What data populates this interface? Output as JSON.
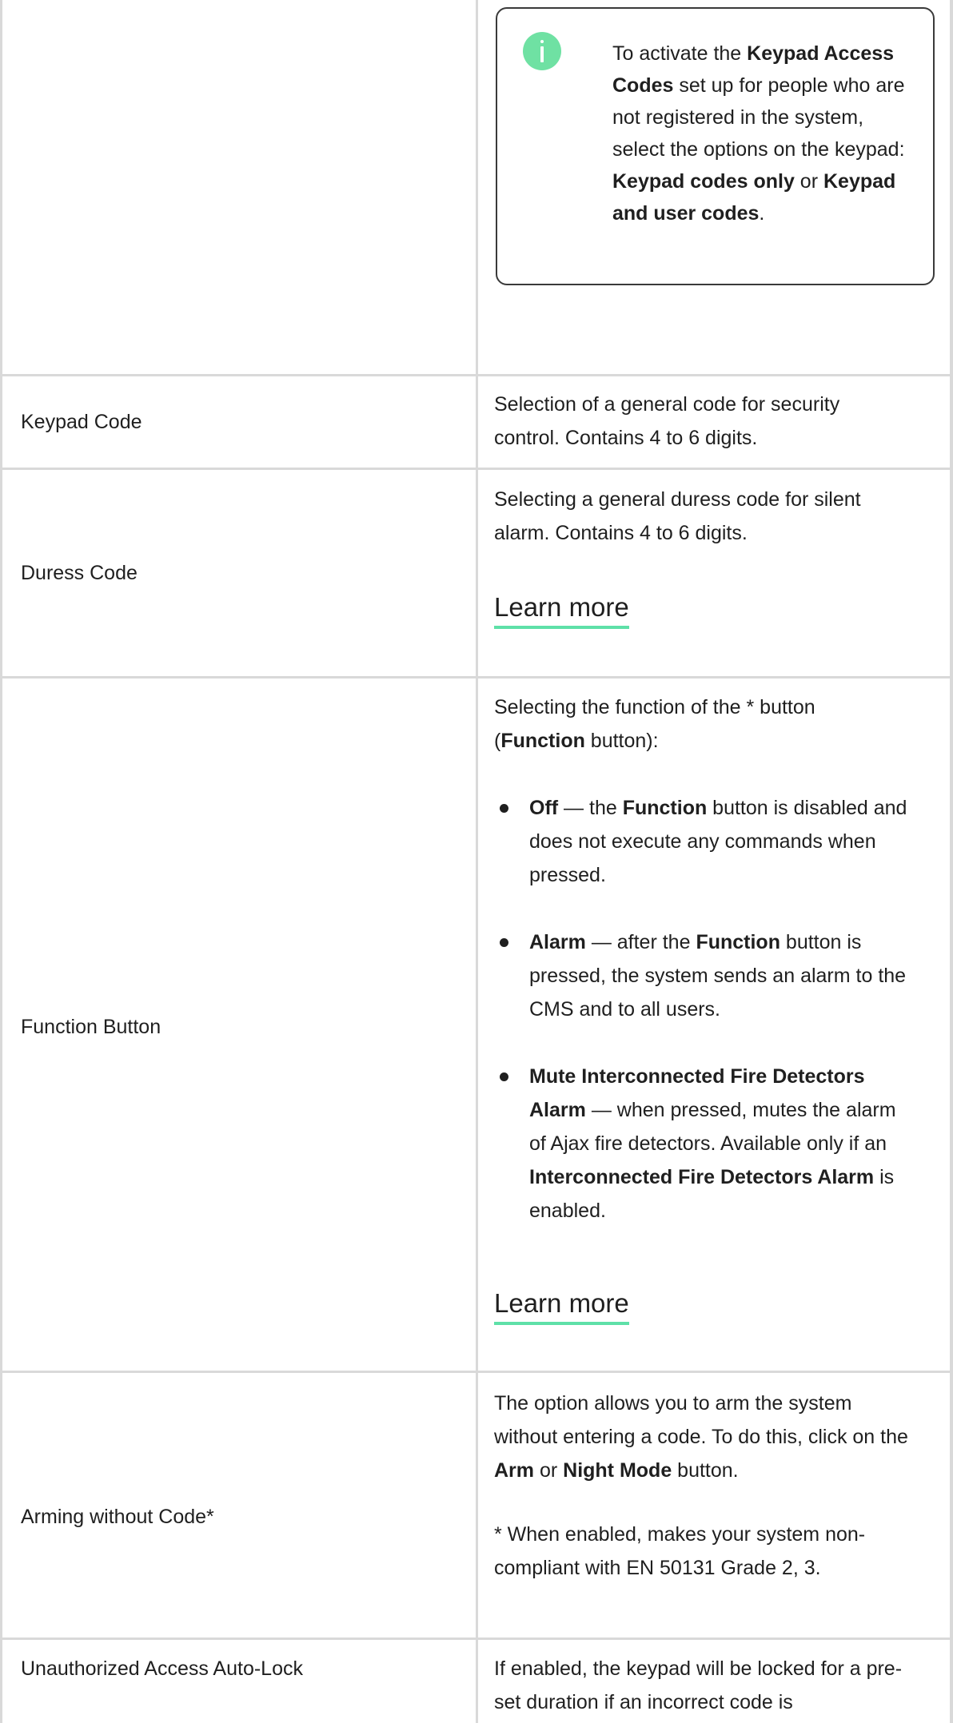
{
  "info_note": {
    "icon": "info-icon",
    "t1": "To activate the ",
    "b1": "Keypad Access Codes",
    "t2": " set up for people who are not registered in the system, select the options on the keypad: ",
    "b2": "Keypad codes only",
    "t3": " or ",
    "b3": "Keypad and user codes",
    "t4": "."
  },
  "rows": {
    "keypad_code": {
      "label": "Keypad Code",
      "description": "Selection of a general code for security control. Contains 4 to 6 digits."
    },
    "duress_code": {
      "label": "Duress Code",
      "description": "Selecting a general duress code for silent alarm. Contains 4 to 6 digits.",
      "link": "Learn more"
    },
    "function_button": {
      "label": "Function Button",
      "intro_t1": "Selecting the function of the * button (",
      "intro_b1": "Function",
      "intro_t2": " button):",
      "items": [
        {
          "b1": "Off",
          "t1": " — the ",
          "b2": "Function",
          "t2": " button is disabled and does not execute any commands when pressed."
        },
        {
          "b1": "Alarm",
          "t1": " — after the ",
          "b2": "Function",
          "t2": " button is pressed, the system sends an alarm to the CMS and to all users."
        },
        {
          "b1": "Mute Interconnected Fire Detectors Alarm",
          "t1": " — when pressed, mutes the alarm of Ajax fire detectors. Available only if an ",
          "b2": "Interconnected Fire Detectors Alarm",
          "t2": " is enabled."
        }
      ],
      "link": "Learn more"
    },
    "arming_without_code": {
      "label": "Arming without Code*",
      "t1": "The option allows you to arm the system without entering a code. To do this, click on the ",
      "b1": "Arm",
      "t2": " or ",
      "b2": "Night Mode",
      "t3": " button.",
      "footnote": "* When enabled, makes your system non-compliant with EN 50131 Grade 2, 3."
    },
    "auto_lock": {
      "label": "Unauthorized Access Auto-Lock",
      "description": "If enabled, the keypad will be locked for a pre-set duration if an incorrect code is"
    }
  }
}
